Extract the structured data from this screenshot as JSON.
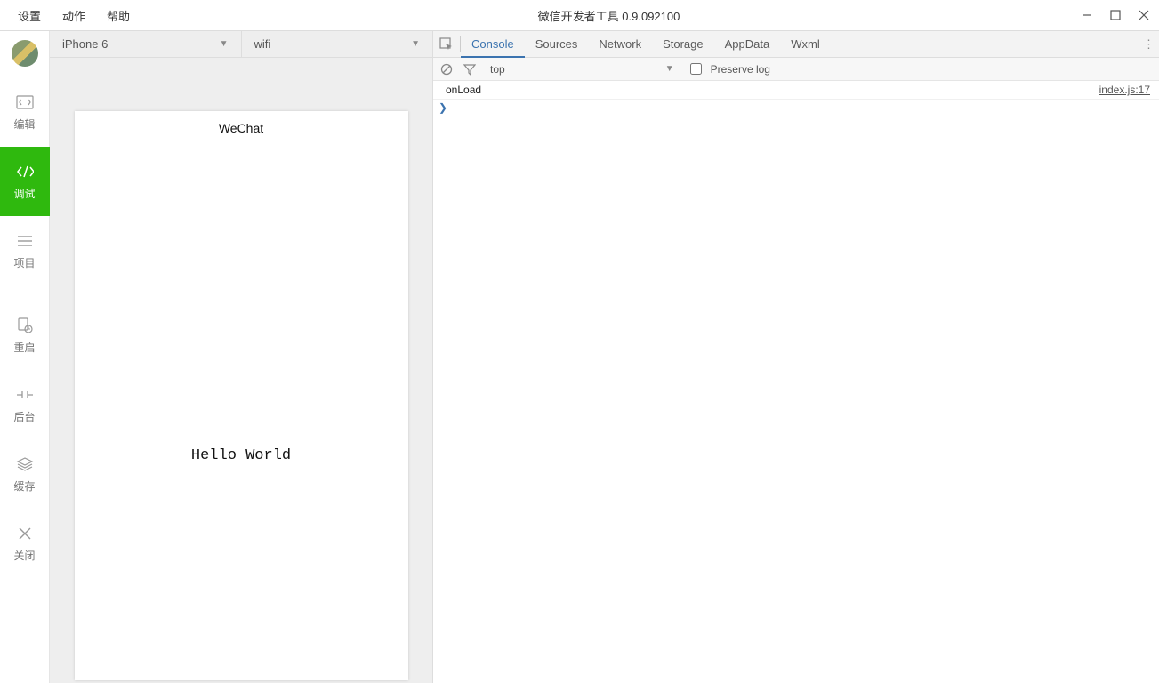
{
  "titlebar": {
    "menu": [
      "设置",
      "动作",
      "帮助"
    ],
    "title": "微信开发者工具 0.9.092100"
  },
  "sidebar": {
    "items": [
      {
        "label": "编辑"
      },
      {
        "label": "调试"
      },
      {
        "label": "项目"
      },
      {
        "label": "重启"
      },
      {
        "label": "后台"
      },
      {
        "label": "缓存"
      },
      {
        "label": "关闭"
      }
    ],
    "active_index": 1
  },
  "simulator": {
    "device": "iPhone 6",
    "network": "wifi",
    "app_title": "WeChat",
    "content_text": "Hello World"
  },
  "devtools": {
    "tabs": [
      "Console",
      "Sources",
      "Network",
      "Storage",
      "AppData",
      "Wxml"
    ],
    "active_index": 0,
    "filter_scope": "top",
    "preserve_log_label": "Preserve log",
    "console_entries": [
      {
        "message": "onLoad",
        "source": "index.js:17"
      }
    ]
  }
}
